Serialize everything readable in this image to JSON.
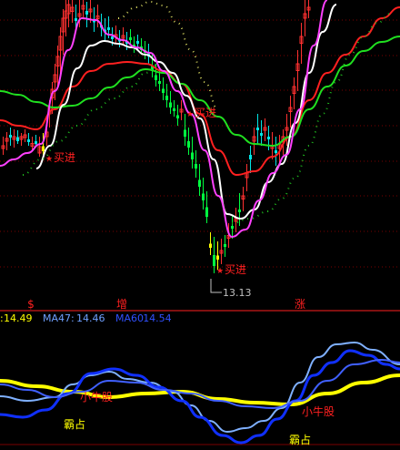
{
  "colors": {
    "background": "#000000",
    "grid": "#7a0000",
    "candle_up": "#ff3030",
    "candle_down": "#00e5e5",
    "candle_green": "#00ff40",
    "candle_yellow": "#ffff00",
    "ma_white": "#ffffff",
    "ma_red": "#ff2020",
    "ma_green": "#20e020",
    "ma_magenta": "#ff40ff",
    "ma_dotted": "#20c020",
    "ma_yellow_dotted": "#d8d860",
    "label_red": "#ff2020",
    "label_yellow": "#ffff00",
    "label_blue": "#3050ff",
    "label_cyan": "#6fa0ff",
    "ind_yellow": "#ffff00",
    "ind_light_blue": "#7fb0ff",
    "ind_blue": "#1030ff",
    "ind_mid_blue": "#4060ff",
    "red_axis": "#ff2020"
  },
  "chart_data": {
    "type": "candlestick",
    "price_range": [
      12.2,
      20.0
    ],
    "low_marker": {
      "label": "13.13",
      "value": 13.13
    },
    "annotations": [
      {
        "id": "buy1",
        "text": "买进"
      },
      {
        "id": "buy2",
        "text": "买进"
      },
      {
        "id": "buy3",
        "text": "买进"
      }
    ],
    "axis_labels": [
      "$",
      "增",
      "涨"
    ],
    "legend": [
      {
        "name": "",
        "value": "14.49",
        "color": "#ffff00"
      },
      {
        "name": "MA47:",
        "value": "14.46",
        "color": "#6fa0ff"
      },
      {
        "name": "MA60",
        "value": "14.54",
        "color": "#3050ff"
      }
    ],
    "indicator_labels": [
      {
        "id": "xn1",
        "text": "小牛股",
        "color": "#ff2020"
      },
      {
        "id": "bz1",
        "text": "霸占",
        "color": "#ffff00"
      },
      {
        "id": "xn2",
        "text": "小牛股",
        "color": "#ff2020"
      },
      {
        "id": "bz2",
        "text": "霸占",
        "color": "#ffff00"
      }
    ]
  }
}
